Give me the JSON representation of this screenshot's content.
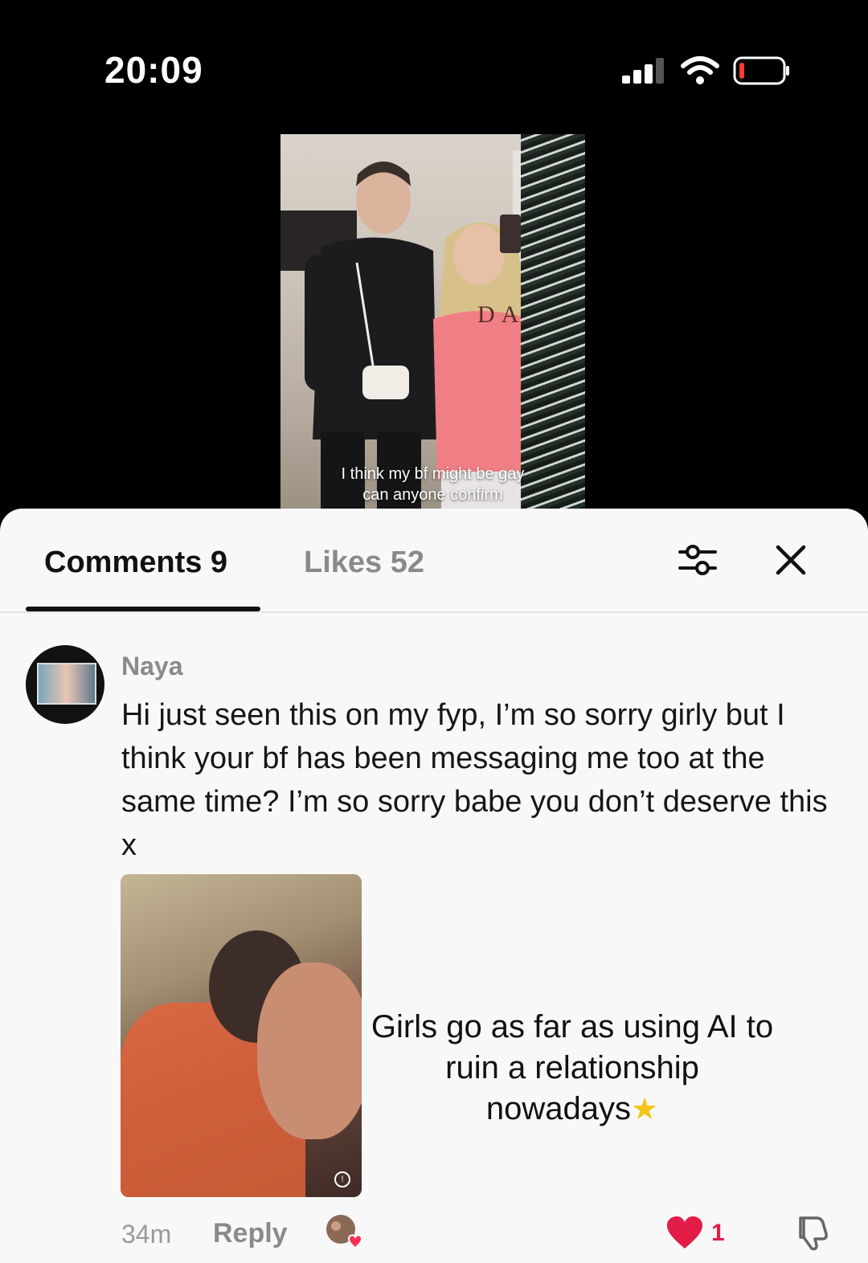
{
  "status_bar": {
    "time": "20:09"
  },
  "video": {
    "caption_line1": "I think my bf might be gay",
    "caption_line2": "can anyone confirm",
    "sweater_letters": "DA"
  },
  "tabs": {
    "comments_label": "Comments 9",
    "likes_label": "Likes 52"
  },
  "comment": {
    "username": "Naya",
    "text": "Hi just seen this on my fyp, I’m so sorry girly but I think your bf has been messaging me too at the same time? I’m so sorry babe you don’t deserve this x",
    "overlay_text_line1": "Girls go as far as using AI to",
    "overlay_text_line2": "ruin a relationship",
    "overlay_text_line3": "nowadays",
    "time_ago": "34m",
    "reply_label": "Reply",
    "like_count": "1"
  },
  "colors": {
    "accent_like": "#e11d48",
    "tab_active": "#111111",
    "tab_inactive": "#8a8a8a"
  }
}
